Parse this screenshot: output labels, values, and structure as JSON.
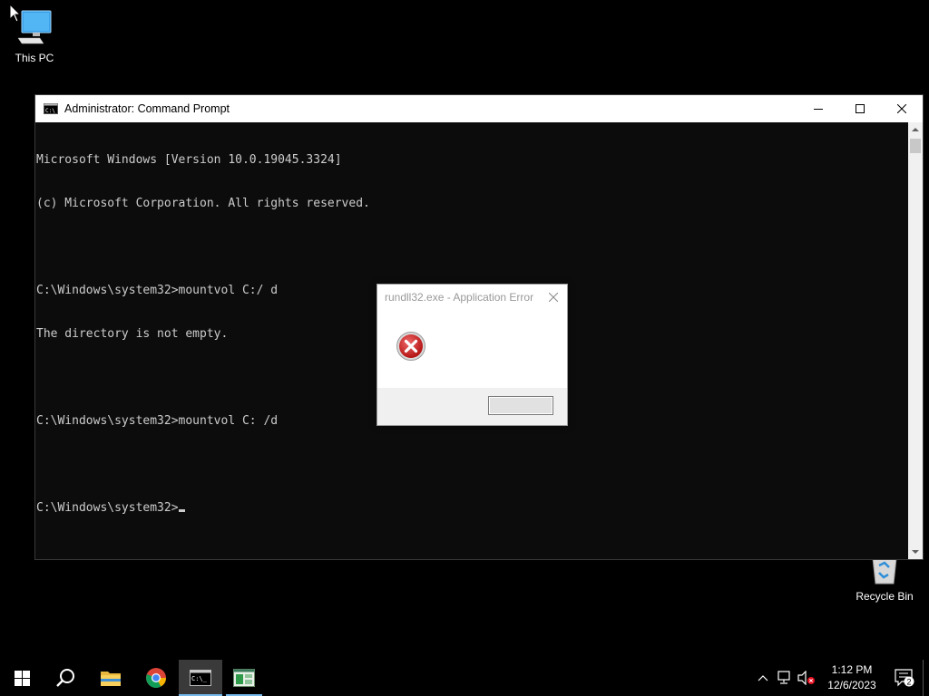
{
  "desktop": {
    "icons": [
      {
        "label": "This PC",
        "icon": "computer-icon"
      },
      {
        "label": "Recycle Bin",
        "icon": "recycle-bin-icon"
      }
    ]
  },
  "cmd_window": {
    "title": "Administrator: Command Prompt",
    "lines": [
      "Microsoft Windows [Version 10.0.19045.3324]",
      "(c) Microsoft Corporation. All rights reserved.",
      "",
      "C:\\Windows\\system32>mountvol C:/ d",
      "The directory is not empty.",
      "",
      "C:\\Windows\\system32>mountvol C: /d",
      ""
    ],
    "prompt": "C:\\Windows\\system32>",
    "colors": {
      "background": "#0c0c0c",
      "text": "#cccccc"
    }
  },
  "error_dialog": {
    "title": "rundll32.exe - Application Error",
    "icon": "error-icon",
    "message": "",
    "ok_label": ""
  },
  "taskbar": {
    "items": [
      {
        "name": "start",
        "icon": "windows-logo-icon"
      },
      {
        "name": "search",
        "icon": "search-icon"
      },
      {
        "name": "file-explorer",
        "icon": "folder-icon"
      },
      {
        "name": "chrome",
        "icon": "chrome-icon"
      },
      {
        "name": "command-prompt",
        "icon": "cmd-icon",
        "active": true
      },
      {
        "name": "task-manager",
        "icon": "task-manager-icon"
      }
    ],
    "tray": {
      "time": "1:12 PM",
      "date": "12/6/2023",
      "notification_count": "2"
    }
  },
  "accent_color": "#76b9ed"
}
